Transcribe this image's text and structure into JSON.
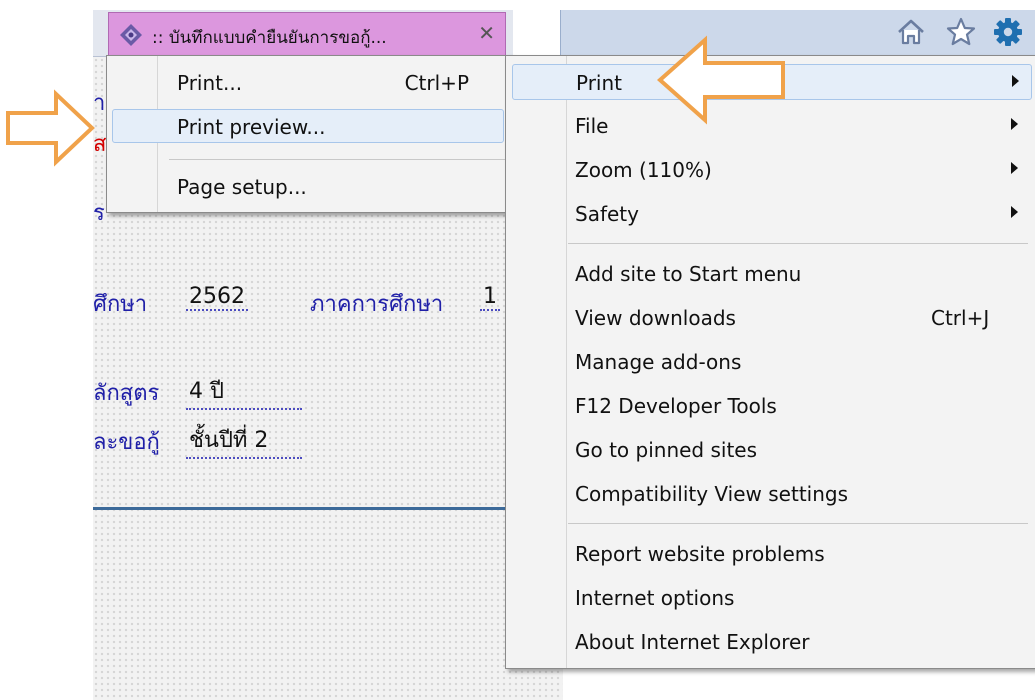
{
  "tab": {
    "title": ":: บันทึกแบบคำยืนยันการขอกู้...",
    "close_glyph": "✕"
  },
  "toolbar": {
    "icons": [
      "home-icon",
      "star-icon",
      "gear-icon"
    ]
  },
  "colors": {
    "tab_bg": "#dc97de",
    "menu_bg": "#f3f3f3",
    "highlight": "#e5eef9",
    "arrow": "#f0a24a",
    "page_text": "#2020a8"
  },
  "page": {
    "fragment_left_1": "า",
    "fragment_left_2": "ส",
    "fragment_left_3": "ร",
    "year_label": "ศึกษา",
    "year_value": "2562",
    "semester_label": "ภาคการศึกษา",
    "semester_value": "1",
    "course_label": "ลักสูตร",
    "course_value": "4  ปี",
    "request_label": "ละขอกู้",
    "request_value": "ชั้นปีที่  2"
  },
  "print_submenu": {
    "items": [
      {
        "label": "Print...",
        "shortcut": "Ctrl+P"
      },
      {
        "label": "Print preview...",
        "shortcut": ""
      },
      {
        "label": "Page setup...",
        "shortcut": ""
      }
    ]
  },
  "tools_menu": {
    "items": [
      {
        "label": "Print",
        "shortcut": ""
      },
      {
        "label": "File",
        "shortcut": ""
      },
      {
        "label": "Zoom (110%)",
        "shortcut": ""
      },
      {
        "label": "Safety",
        "shortcut": ""
      },
      {
        "label": "Add site to Start menu",
        "shortcut": ""
      },
      {
        "label": "View downloads",
        "shortcut": "Ctrl+J"
      },
      {
        "label": "Manage add-ons",
        "shortcut": ""
      },
      {
        "label": "F12 Developer Tools",
        "shortcut": ""
      },
      {
        "label": "Go to pinned sites",
        "shortcut": ""
      },
      {
        "label": "Compatibility View settings",
        "shortcut": ""
      },
      {
        "label": "Report website problems",
        "shortcut": ""
      },
      {
        "label": "Internet options",
        "shortcut": ""
      },
      {
        "label": "About Internet Explorer",
        "shortcut": ""
      }
    ]
  }
}
